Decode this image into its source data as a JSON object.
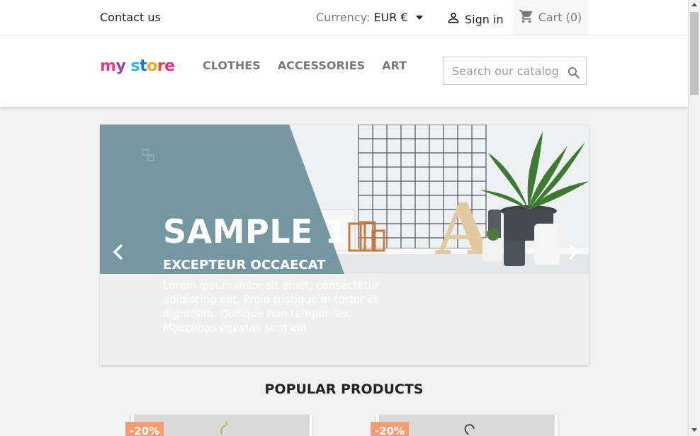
{
  "topnav": {
    "contact_label": "Contact us",
    "currency_label": "Currency:",
    "currency_value": "EUR €",
    "signin_label": "Sign in",
    "cart_label": "Cart (0)"
  },
  "header": {
    "logo_text": "my store",
    "menu": [
      "CLOTHES",
      "ACCESSORIES",
      "ART"
    ],
    "search_placeholder": "Search our catalog"
  },
  "carousel": {
    "title": "SAMPLE 1",
    "subtitle": "EXCEPTEUR OCCAECAT",
    "description": "Lorem ipsum dolor sit amet, consectetur adipiscing elit. Proin tristique in tortor et dignissim. Quisque non tempor leo. Maecenas egestas sem elit",
    "banner_color": "#7597a2"
  },
  "popular": {
    "title": "POPULAR PRODUCTS",
    "products": [
      {
        "discount": "-20%"
      },
      {
        "discount": "-20%"
      }
    ]
  },
  "colors": {
    "accent": "#24b9d7",
    "badge": "#f39d72"
  }
}
